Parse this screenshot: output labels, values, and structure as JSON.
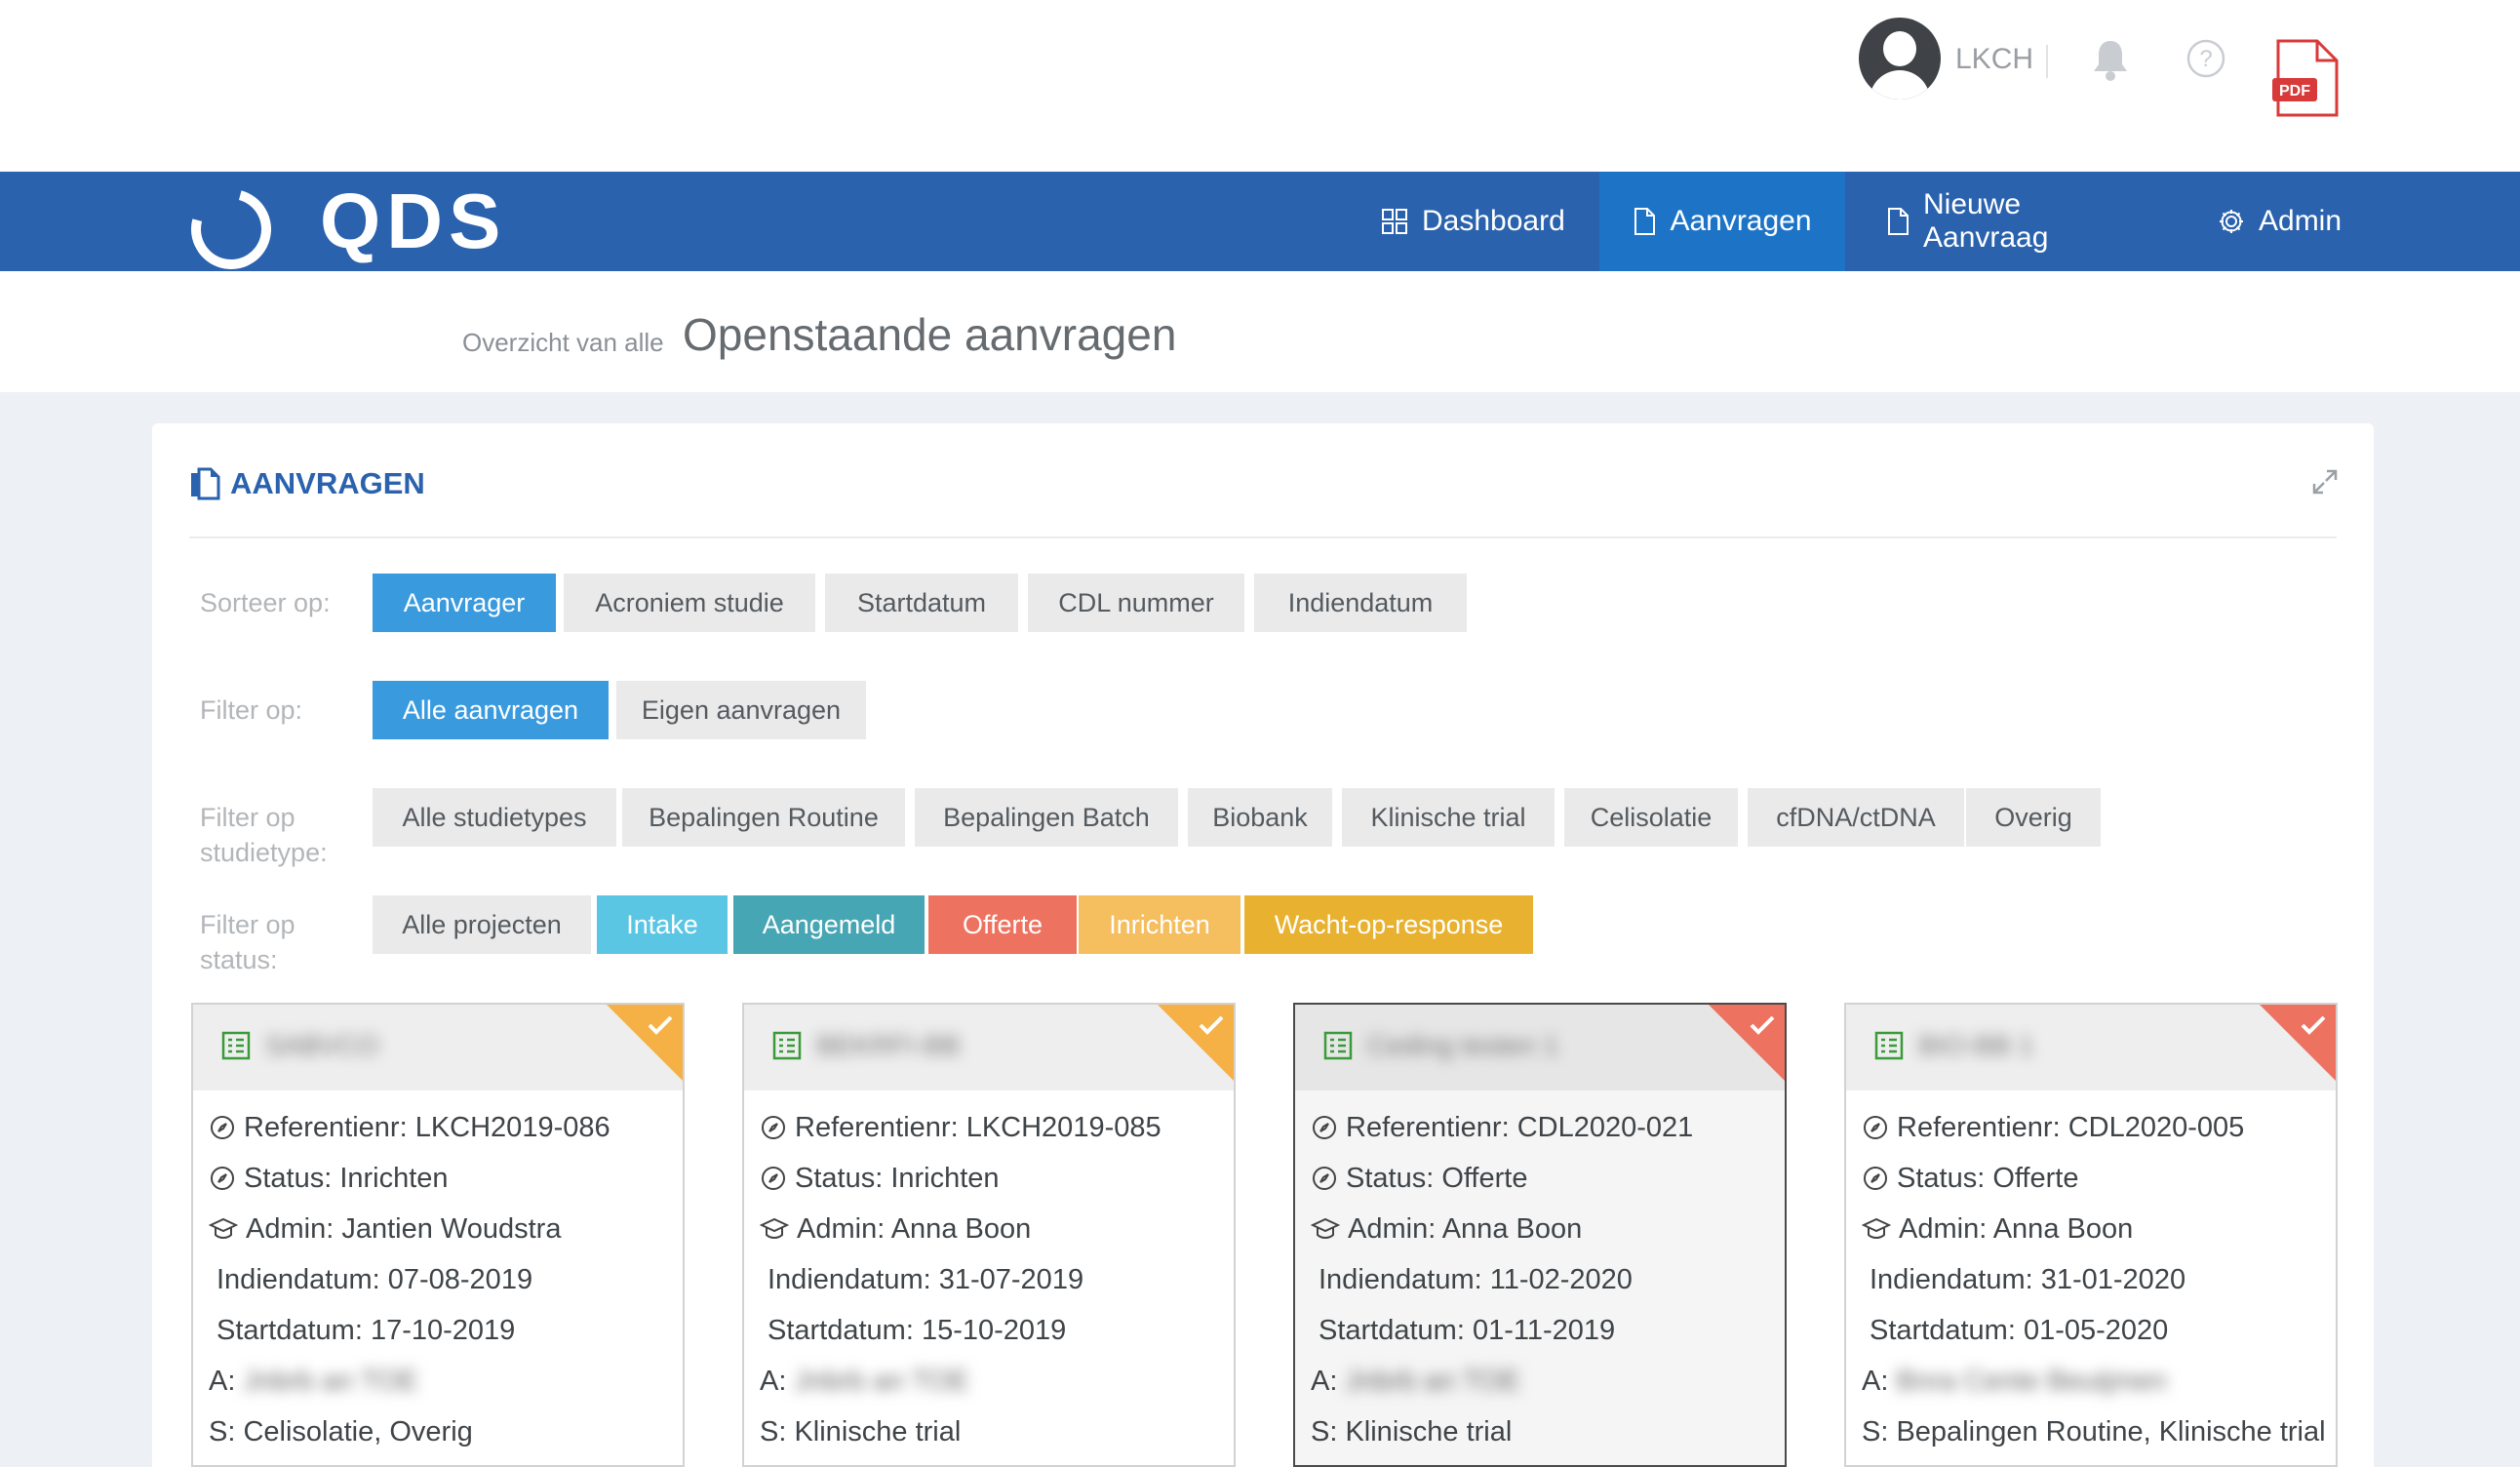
{
  "topbar": {
    "user": "LKCH",
    "pdf_label": "PDF"
  },
  "navbar": {
    "logo": "QDS",
    "items": [
      {
        "label": "Dashboard",
        "icon": "grid-icon"
      },
      {
        "label": "Aanvragen",
        "icon": "document-icon",
        "active": true
      },
      {
        "label": "Nieuwe Aanvraag",
        "icon": "document-icon"
      },
      {
        "label": "Admin",
        "icon": "gear-icon"
      }
    ]
  },
  "page": {
    "subtitle": "Overzicht van alle",
    "title": "Openstaande aanvragen"
  },
  "panel": {
    "title": "AANVRAGEN",
    "sort": {
      "label": "Sorteer op:",
      "options": [
        "Aanvrager",
        "Acroniem studie",
        "Startdatum",
        "CDL nummer",
        "Indiendatum"
      ]
    },
    "filter": {
      "label": "Filter op:",
      "options": [
        "Alle aanvragen",
        "Eigen aanvragen"
      ]
    },
    "studytype": {
      "label_line1": "Filter op",
      "label_line2": "studietype:",
      "options": [
        "Alle studietypes",
        "Bepalingen Routine",
        "Bepalingen Batch",
        "Biobank",
        "Klinische trial",
        "Celisolatie",
        "cfDNA/ctDNA",
        "Overig"
      ]
    },
    "status": {
      "label_line1": "Filter op",
      "label_line2": "status:",
      "options": [
        "Alle projecten",
        "Intake",
        "Aangemeld",
        "Offerte",
        "Inrichten",
        "Wacht-op-response"
      ]
    }
  },
  "cards": [
    {
      "title": "SABVCO",
      "ref": "Referentienr: LKCH2019-086",
      "status": "Status: Inrichten",
      "admin": "Admin: Jantien Woudstra",
      "indiendatum": "Indiendatum: 07-08-2019",
      "startdatum": "Startdatum: 17-10-2019",
      "a_prefix": "A:",
      "a_value": "Jnbrb an TOE",
      "s": "S: Celisolatie, Overig",
      "corner_color": "#f5b146"
    },
    {
      "title": "BEKRFI-BB",
      "ref": "Referentienr: LKCH2019-085",
      "status": "Status: Inrichten",
      "admin": "Admin: Anna Boon",
      "indiendatum": "Indiendatum: 31-07-2019",
      "startdatum": "Startdatum: 15-10-2019",
      "a_prefix": "A:",
      "a_value": "Jnbrb an TOE",
      "s": "S: Klinische trial",
      "corner_color": "#f5b146"
    },
    {
      "title": "Ceding testen 1",
      "ref": "Referentienr: CDL2020-021",
      "status": "Status: Offerte",
      "admin": "Admin: Anna Boon",
      "indiendatum": "Indiendatum: 11-02-2020",
      "startdatum": "Startdatum: 01-11-2019",
      "a_prefix": "A:",
      "a_value": "Jnbrb an TOE",
      "s": "S: Klinische trial",
      "corner_color": "#ee7260"
    },
    {
      "title": "BIO-BB 1",
      "ref": "Referentienr: CDL2020-005",
      "status": "Status: Offerte",
      "admin": "Admin: Anna Boon",
      "indiendatum": "Indiendatum: 31-01-2020",
      "startdatum": "Startdatum: 01-05-2020",
      "a_prefix": "A:",
      "a_value": "Bnra Cente Beutjmen",
      "s": "S: Bepalingen Routine, Klinische trial",
      "corner_color": "#ee7260"
    }
  ]
}
